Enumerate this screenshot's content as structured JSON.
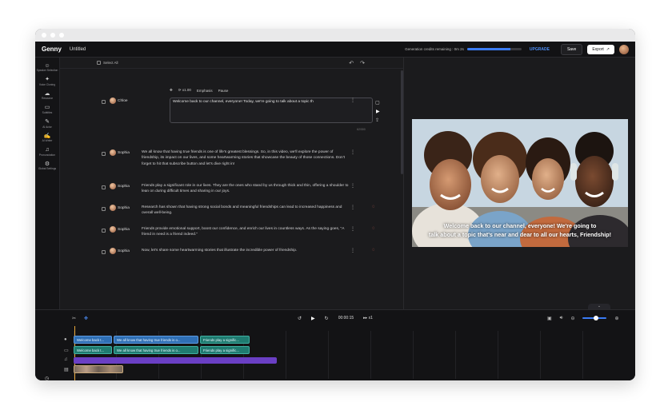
{
  "app": {
    "logo": "Genny",
    "doc_title": "Untitled"
  },
  "header": {
    "credits_label": "Generation credits remaining : 0m 2s",
    "credits_fraction": 0.8,
    "upgrade": "UPGRADE",
    "save": "Save",
    "export": "Export",
    "export_icon": "↗"
  },
  "sidebar": {
    "items": [
      {
        "label": "Speaker Selection",
        "icon": "☺",
        "icon_name": "speaker-icon"
      },
      {
        "label": "Voice Cloning",
        "icon": "✦",
        "icon_name": "sparkle-icon"
      },
      {
        "label": "Resource",
        "icon": "☁",
        "icon_name": "cloud-icon"
      },
      {
        "label": "Subtitles",
        "icon": "▭",
        "icon_name": "subtitles-icon"
      },
      {
        "label": "AI Actor",
        "icon": "✎",
        "icon_name": "wand-icon"
      },
      {
        "label": "AI Writer",
        "icon": "✍",
        "icon_name": "pen-icon"
      },
      {
        "label": "Pronunciation",
        "icon": "♫",
        "icon_name": "headphones-icon"
      },
      {
        "label": "Global Settings",
        "icon": "⚙",
        "icon_name": "gear-icon"
      }
    ]
  },
  "script": {
    "select_all": "Select All",
    "undo_icon": "↶",
    "redo_icon": "↷",
    "controls": {
      "speed": "x1.00",
      "emphasis": "Emphasis",
      "pause": "Pause"
    },
    "char_count": "62/300",
    "rows": [
      {
        "speaker": "Chloe",
        "text": "Welcome back to our channel, everyone! Today, we're going to talk about a topic th"
      },
      {
        "speaker": "Sophia",
        "text": "We all know that having true friends is one of life's greatest blessings. So, in this video, we'll explore the power of friendship, its impact on our lives, and some heartwarming stories that showcase the beauty of those connections. Don't forget to hit that subscribe button and let's dive right in!"
      },
      {
        "speaker": "Sophia",
        "text": "Friends play a significant role in our lives. They are the ones who stand by us through thick and thin, offering a shoulder to lean on during difficult times and sharing in our joys."
      },
      {
        "speaker": "Sophia",
        "text": "Research has shown that having strong social bonds and meaningful friendships can lead to increased happiness and overall well-being."
      },
      {
        "speaker": "Sophia",
        "text": "Friends provide emotional support, boost our confidence, and enrich our lives in countless ways. As the saying goes, \"A friend in need is a friend indeed.\""
      },
      {
        "speaker": "Sophia",
        "text": "Now, let's share some heartwarming stories that illustrate the incredible power of friendship."
      }
    ]
  },
  "preview": {
    "caption_line1": "Welcome back to our channel, everyone! We're going to",
    "caption_line2": "talk about a topic that's near and dear to all our hearts, Friendship!",
    "collapse_icon": "⌄"
  },
  "timeline": {
    "time": "00:00:15",
    "speed": "x1",
    "track1_clips": [
      "Welcome back t...",
      "We all know that having true friends is o...",
      "Friends play a signific..."
    ],
    "track2_clips": [
      "Welcome back t...",
      "We all know that having true friends is o...",
      "Friends play a signific..."
    ],
    "zoom_fraction": 0.55
  }
}
